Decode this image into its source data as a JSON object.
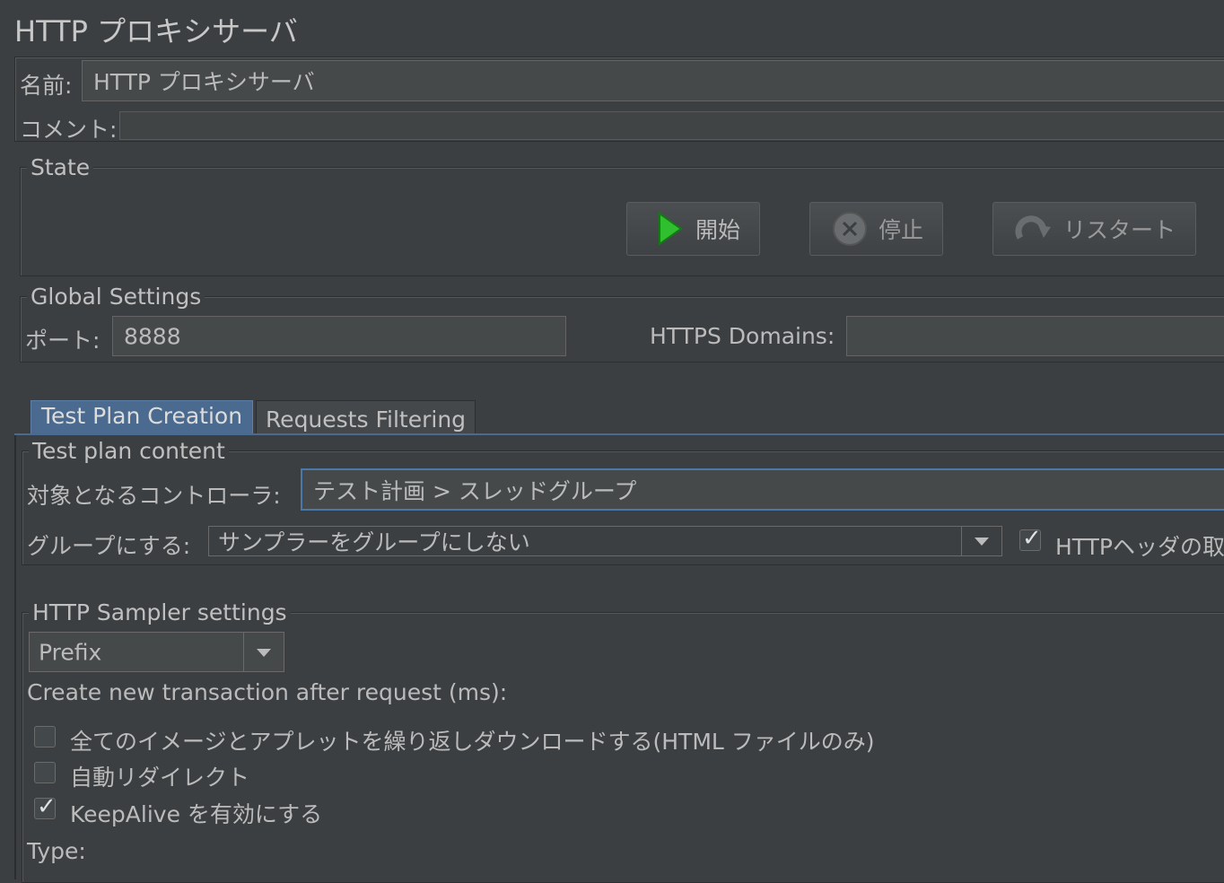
{
  "title": "HTTP プロキシサーバ",
  "name": {
    "label": "名前:",
    "value": "HTTP プロキシサーバ"
  },
  "comment": {
    "label": "コメント:",
    "value": ""
  },
  "state": {
    "legend": "State",
    "start_label": "開始",
    "stop_label": "停止",
    "restart_label": "リスタート"
  },
  "global": {
    "legend": "Global Settings",
    "port_label": "ポート:",
    "port_value": "8888",
    "https_label": "HTTPS Domains:",
    "https_value": ""
  },
  "tabs": [
    {
      "label": "Test Plan Creation",
      "selected": true
    },
    {
      "label": "Requests Filtering",
      "selected": false
    }
  ],
  "content": {
    "legend": "Test plan content",
    "target_label": "対象となるコントローラ:",
    "target_value": "テスト計画 > スレッドグループ",
    "group_label": "グループにする:",
    "group_value": "サンプラーをグループにしない",
    "header_checkbox_label": "HTTPヘッダの取",
    "header_checked": true
  },
  "sampler": {
    "legend": "HTTP Sampler settings",
    "prefix_value": "Prefix",
    "transaction_label": "Create new transaction after request (ms):",
    "options": [
      {
        "label": "全てのイメージとアプレットを繰り返しダウンロードする(HTML ファイルのみ)",
        "checked": false
      },
      {
        "label": "自動リダイレクト",
        "checked": false
      },
      {
        "label": "KeepAlive を有効にする",
        "checked": true
      }
    ],
    "type_label": "Type:"
  },
  "colors": {
    "background": "#3c3f41",
    "accent": "#4a78a8",
    "play": "#2fbf2f"
  }
}
